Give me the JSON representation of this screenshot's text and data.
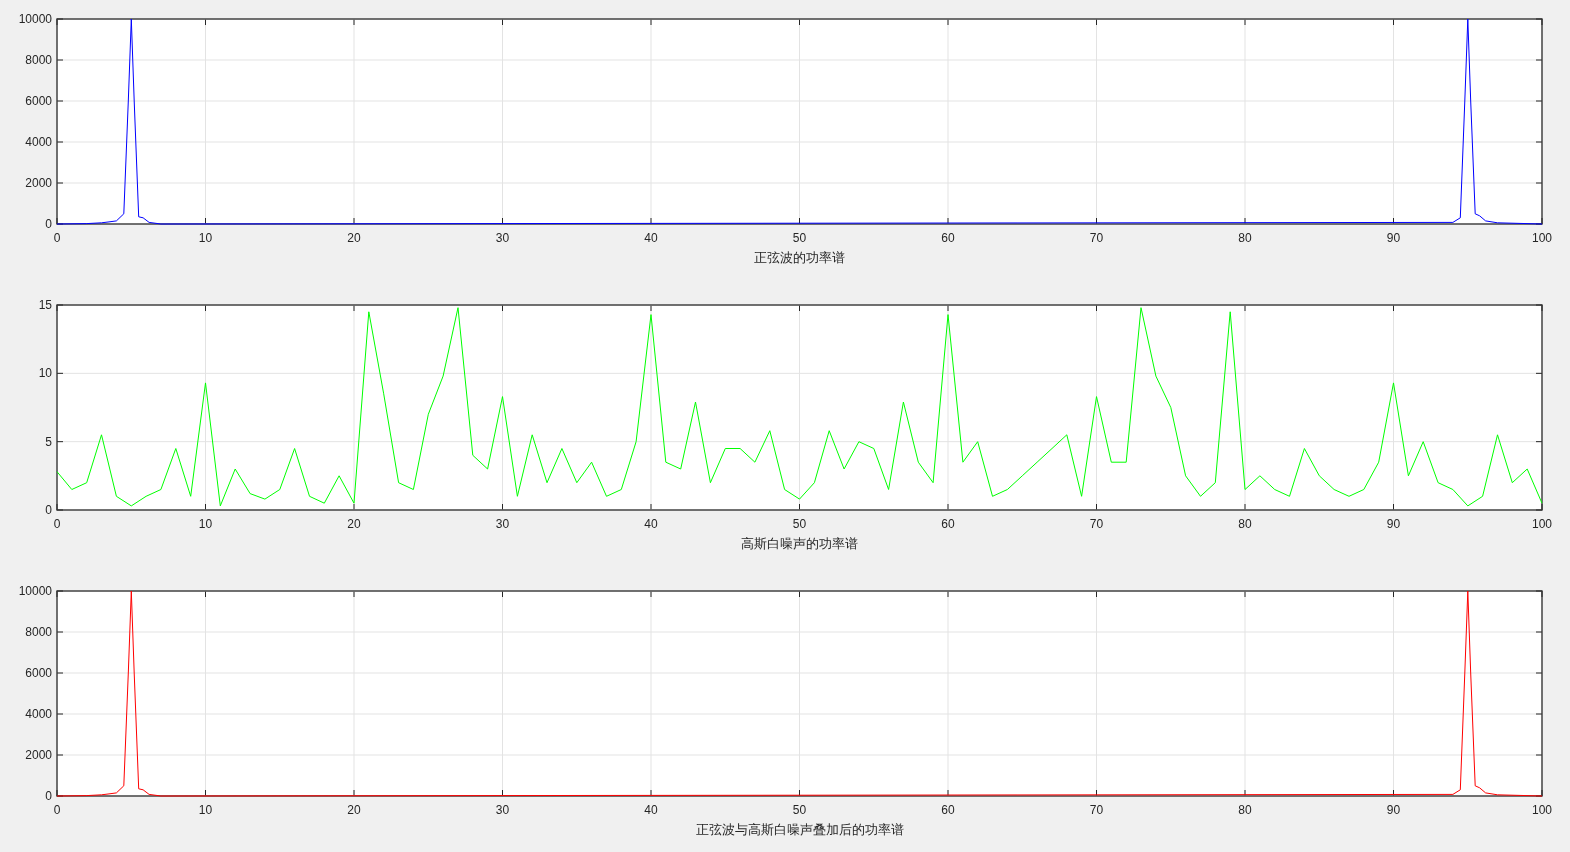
{
  "figure": {
    "plots": [
      {
        "chart_data": {
          "type": "line",
          "grid": true,
          "xlabel": "正弦波的功率谱",
          "xlim": [
            0,
            100
          ],
          "ylim": [
            0,
            10000
          ],
          "xticks": [
            0,
            10,
            20,
            30,
            40,
            50,
            60,
            70,
            80,
            90,
            100
          ],
          "yticks": [
            0,
            2000,
            4000,
            6000,
            8000,
            10000
          ],
          "x": [
            0,
            2,
            3,
            3.5,
            4,
            4.5,
            4.8,
            5,
            5.2,
            5.5,
            5.8,
            6.2,
            7,
            94,
            94.5,
            94.8,
            95,
            95.2,
            95.5,
            95.8,
            96.2,
            97,
            100
          ],
          "series": [
            {
              "color": "#0000ff",
              "values": [
                0,
                20,
                60,
                100,
                150,
                500,
                6000,
                10000,
                6000,
                350,
                300,
                80,
                0,
                80,
                300,
                6000,
                10000,
                6000,
                500,
                400,
                150,
                60,
                0
              ]
            }
          ]
        }
      },
      {
        "chart_data": {
          "type": "line",
          "grid": true,
          "xlabel": "高斯白噪声的功率谱",
          "xlim": [
            0,
            100
          ],
          "ylim": [
            0,
            15
          ],
          "xticks": [
            0,
            10,
            20,
            30,
            40,
            50,
            60,
            70,
            80,
            90,
            100
          ],
          "yticks": [
            0,
            5,
            10,
            15
          ],
          "x": [
            0,
            1,
            2,
            3,
            4,
            5,
            6,
            7,
            8,
            9,
            10,
            11,
            12,
            13,
            14,
            15,
            16,
            17,
            18,
            19,
            20,
            21,
            22,
            23,
            24,
            25,
            26,
            27,
            28,
            29,
            30,
            31,
            32,
            33,
            34,
            35,
            36,
            37,
            38,
            39,
            40,
            41,
            42,
            43,
            44,
            45,
            46,
            47,
            48,
            49,
            50,
            51,
            52,
            53,
            54,
            55,
            56,
            57,
            58,
            59,
            60,
            61,
            62,
            63,
            64,
            65,
            66,
            67,
            68,
            69,
            70,
            71,
            72,
            73,
            74,
            75,
            76,
            77,
            78,
            79,
            80,
            81,
            82,
            83,
            84,
            85,
            86,
            87,
            88,
            89,
            90,
            91,
            92,
            93,
            94,
            95,
            96,
            97,
            98,
            99,
            100
          ],
          "series": [
            {
              "color": "#00ff00",
              "values": [
                2.8,
                1.5,
                2.0,
                5.5,
                1.0,
                0.3,
                1.0,
                1.5,
                4.5,
                1.0,
                9.3,
                0.3,
                3.0,
                1.2,
                0.8,
                1.5,
                4.5,
                1.0,
                0.5,
                2.5,
                0.5,
                14.5,
                8.5,
                2.0,
                1.5,
                7.0,
                9.8,
                14.8,
                4.0,
                3.0,
                8.3,
                1.0,
                5.5,
                2.0,
                4.5,
                2.0,
                3.5,
                1.0,
                1.5,
                5.0,
                14.3,
                3.5,
                3.0,
                7.9,
                2.0,
                4.5,
                4.5,
                3.5,
                5.8,
                1.5,
                0.8,
                2.0,
                5.8,
                3.0,
                5.0,
                4.5,
                1.5,
                7.9,
                3.5,
                2.0,
                14.3,
                3.5,
                5.0,
                1.0,
                1.5,
                2.5,
                3.5,
                4.5,
                5.5,
                1.0,
                8.3,
                3.5,
                3.5,
                14.8,
                9.8,
                7.5,
                2.5,
                1.0,
                2.0,
                14.5,
                1.5,
                2.5,
                1.5,
                1.0,
                4.5,
                2.5,
                1.5,
                1.0,
                1.5,
                3.5,
                9.3,
                2.5,
                5.0,
                2.0,
                1.5,
                0.3,
                1.0,
                5.5,
                2.0,
                3.0,
                0.5
              ]
            }
          ]
        }
      },
      {
        "chart_data": {
          "type": "line",
          "grid": true,
          "xlabel": "正弦波与高斯白噪声叠加后的功率谱",
          "xlim": [
            0,
            100
          ],
          "ylim": [
            0,
            10000
          ],
          "xticks": [
            0,
            10,
            20,
            30,
            40,
            50,
            60,
            70,
            80,
            90,
            100
          ],
          "yticks": [
            0,
            2000,
            4000,
            6000,
            8000,
            10000
          ],
          "x": [
            0,
            2,
            3,
            3.5,
            4,
            4.5,
            4.8,
            5,
            5.2,
            5.5,
            5.8,
            6.2,
            7,
            94,
            94.5,
            94.8,
            95,
            95.2,
            95.5,
            95.8,
            96.2,
            97,
            100
          ],
          "series": [
            {
              "color": "#ff0000",
              "values": [
                0,
                20,
                60,
                100,
                150,
                500,
                6000,
                10000,
                6000,
                350,
                300,
                80,
                0,
                80,
                300,
                6000,
                10000,
                6000,
                500,
                400,
                150,
                60,
                0
              ]
            }
          ]
        }
      }
    ]
  }
}
